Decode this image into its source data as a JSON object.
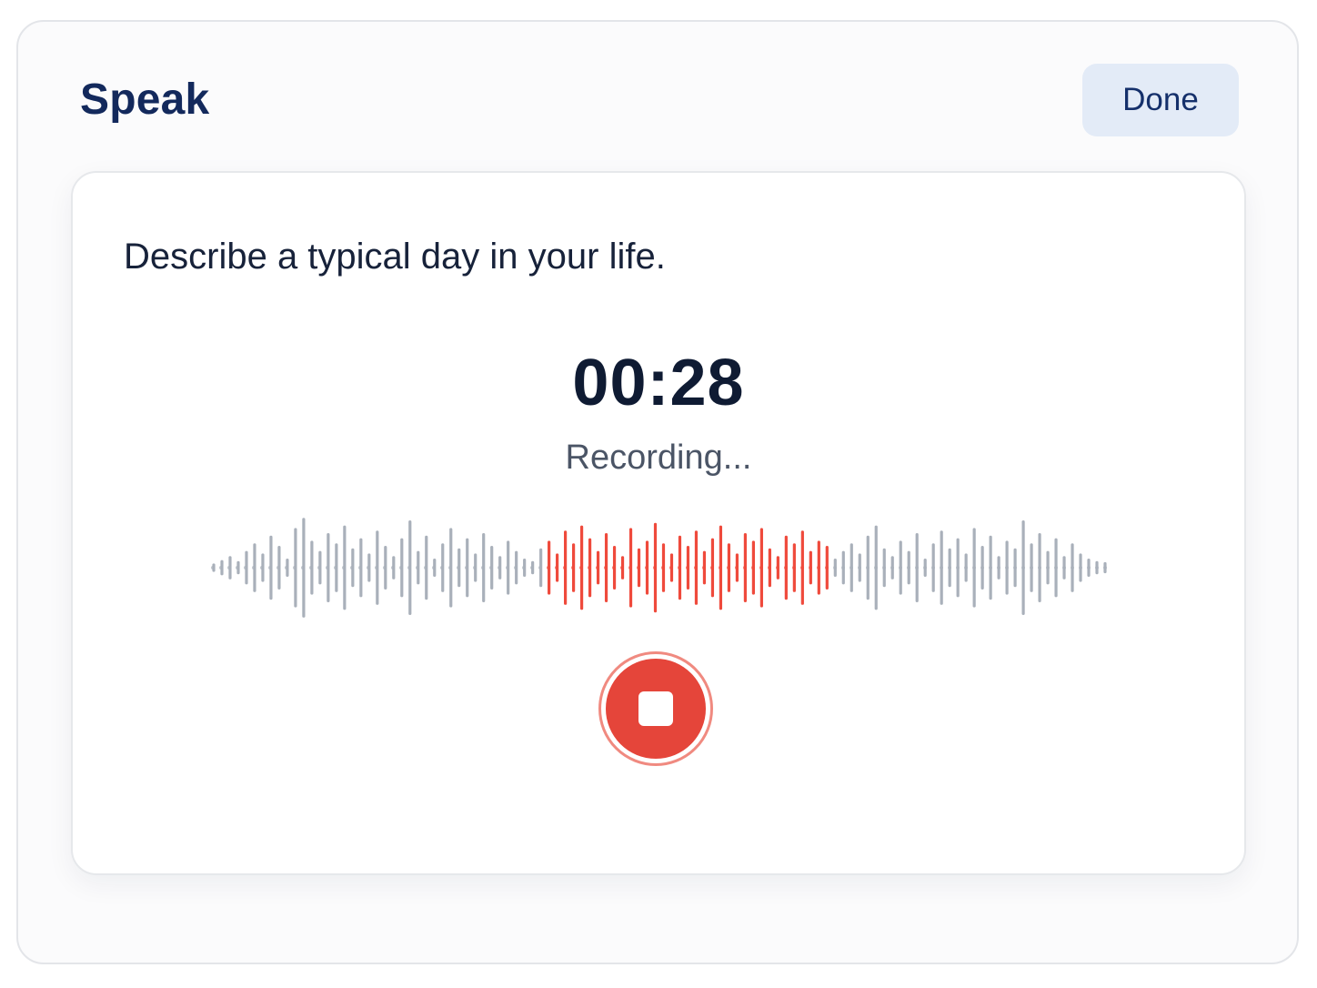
{
  "header": {
    "title": "Speak",
    "done_label": "Done"
  },
  "card": {
    "prompt": "Describe a typical day in your life.",
    "timer": "00:28",
    "status": "Recording..."
  },
  "waveform": {
    "icon": "audio-waveform",
    "active_color": "#ef4a3c",
    "inactive_color": "#a9b0ba",
    "levels": [
      0.05,
      0.12,
      0.2,
      0.1,
      0.3,
      0.45,
      0.25,
      0.6,
      0.4,
      0.15,
      0.75,
      0.95,
      0.5,
      0.3,
      0.65,
      0.45,
      0.8,
      0.35,
      0.55,
      0.25,
      0.7,
      0.4,
      0.2,
      0.55,
      0.9,
      0.3,
      0.6,
      0.15,
      0.45,
      0.75,
      0.35,
      0.55,
      0.25,
      0.65,
      0.4,
      0.2,
      0.5,
      0.3,
      0.15,
      0.1,
      0.35,
      0.5,
      0.25,
      0.7,
      0.45,
      0.8,
      0.55,
      0.3,
      0.65,
      0.4,
      0.2,
      0.75,
      0.35,
      0.5,
      0.85,
      0.45,
      0.25,
      0.6,
      0.4,
      0.7,
      0.3,
      0.55,
      0.8,
      0.45,
      0.25,
      0.65,
      0.5,
      0.75,
      0.35,
      0.2,
      0.6,
      0.45,
      0.7,
      0.3,
      0.5,
      0.4,
      0.15,
      0.3,
      0.45,
      0.25,
      0.6,
      0.8,
      0.35,
      0.2,
      0.5,
      0.3,
      0.65,
      0.15,
      0.45,
      0.7,
      0.35,
      0.55,
      0.25,
      0.75,
      0.4,
      0.6,
      0.2,
      0.5,
      0.35,
      0.9,
      0.45,
      0.65,
      0.3,
      0.55,
      0.2,
      0.45,
      0.25,
      0.15,
      0.1,
      0.08
    ],
    "active_from": 0.375,
    "active_to": 0.69
  },
  "controls": {
    "stop_icon": "stop-icon",
    "stop_color": "#e5453a"
  }
}
